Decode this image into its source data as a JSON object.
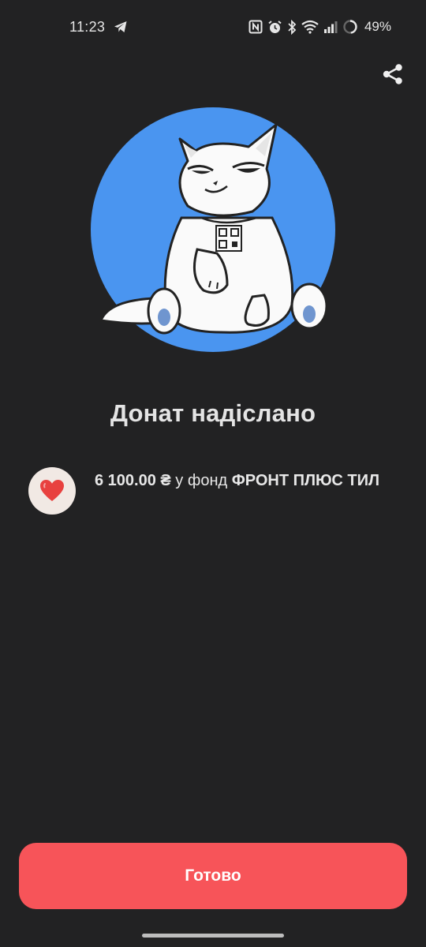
{
  "status_bar": {
    "time": "11:23",
    "battery": "49%",
    "icons": [
      "telegram-icon",
      "nfc-icon",
      "alarm-icon",
      "bluetooth-icon",
      "wifi-icon",
      "signal-icon",
      "battery-icon"
    ]
  },
  "header": {
    "share_icon": "share-icon"
  },
  "main": {
    "title": "Донат надіслано",
    "donation": {
      "amount": "6 100.00 ₴",
      "preposition": " у фонд ",
      "fund_name": "ФРОНТ ПЛЮС ТИЛ",
      "icon": "heart-icon"
    }
  },
  "footer": {
    "done_label": "Готово"
  },
  "colors": {
    "background": "#222223",
    "accent": "#f75459",
    "illustration_circle": "#4a95f0"
  }
}
